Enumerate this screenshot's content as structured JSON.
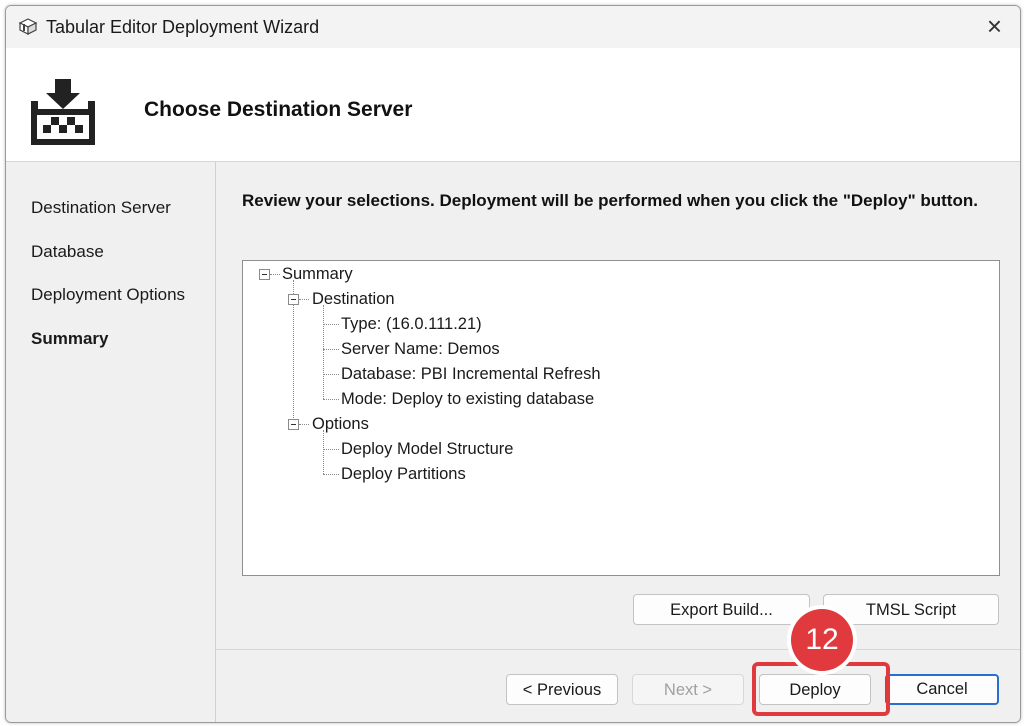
{
  "window": {
    "title": "Tabular Editor Deployment Wizard"
  },
  "header": {
    "title": "Choose Destination Server"
  },
  "sidebar": {
    "items": [
      {
        "label": "Destination Server"
      },
      {
        "label": "Database"
      },
      {
        "label": "Deployment Options"
      },
      {
        "label": "Summary",
        "active": true
      }
    ]
  },
  "main": {
    "instructions": "Review your selections. Deployment will be performed when you click the \"Deploy\" button.",
    "summary_tree": {
      "root": "Summary",
      "destination": {
        "label": "Destination",
        "items": [
          "Type:  (16.0.111.21)",
          "Server Name: Demos",
          "Database: PBI Incremental Refresh",
          "Mode: Deploy to existing database"
        ]
      },
      "options": {
        "label": "Options",
        "items": [
          "Deploy Model Structure",
          "Deploy Partitions"
        ]
      }
    },
    "export_build_label": "Export Build...",
    "tmsl_script_label": "TMSL Script"
  },
  "footer": {
    "previous_label": "< Previous",
    "next_label": "Next >",
    "deploy_label": "Deploy",
    "cancel_label": "Cancel"
  },
  "annotation": {
    "step_number": "12",
    "color": "#e0393e"
  },
  "colors": {
    "accent": "#2a6fd0",
    "highlight": "#e0393e"
  }
}
